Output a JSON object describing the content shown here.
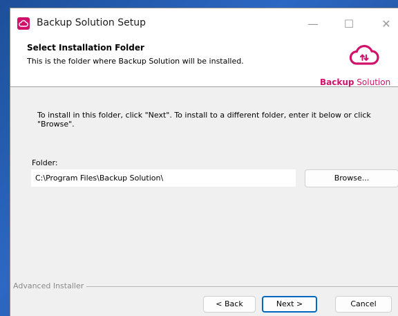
{
  "window": {
    "title": "Backup Solution Setup",
    "min_icon": "minimize-icon",
    "max_icon": "maximize-icon",
    "close_icon": "close-icon",
    "min_glyph": "—",
    "max_glyph": "☐",
    "close_glyph": "✕"
  },
  "header": {
    "title": "Select Installation Folder",
    "subtitle": "This is the folder where Backup Solution will be installed.",
    "brand_bold": "Backup",
    "brand_rest": " Solution",
    "brand_color": "#d1126b"
  },
  "body": {
    "instruction": "To install in this folder, click \"Next\". To install to a different folder, enter it below or click \"Browse\".",
    "folder_label": "Folder:",
    "folder_value": "C:\\Program Files\\Backup Solution\\",
    "browse_label": "Browse..."
  },
  "footer": {
    "group_label": "Advanced Installer",
    "back_label": "< Back",
    "next_label": "Next >",
    "cancel_label": "Cancel"
  },
  "colors": {
    "accent": "#0067c0",
    "brand": "#d1126b"
  }
}
